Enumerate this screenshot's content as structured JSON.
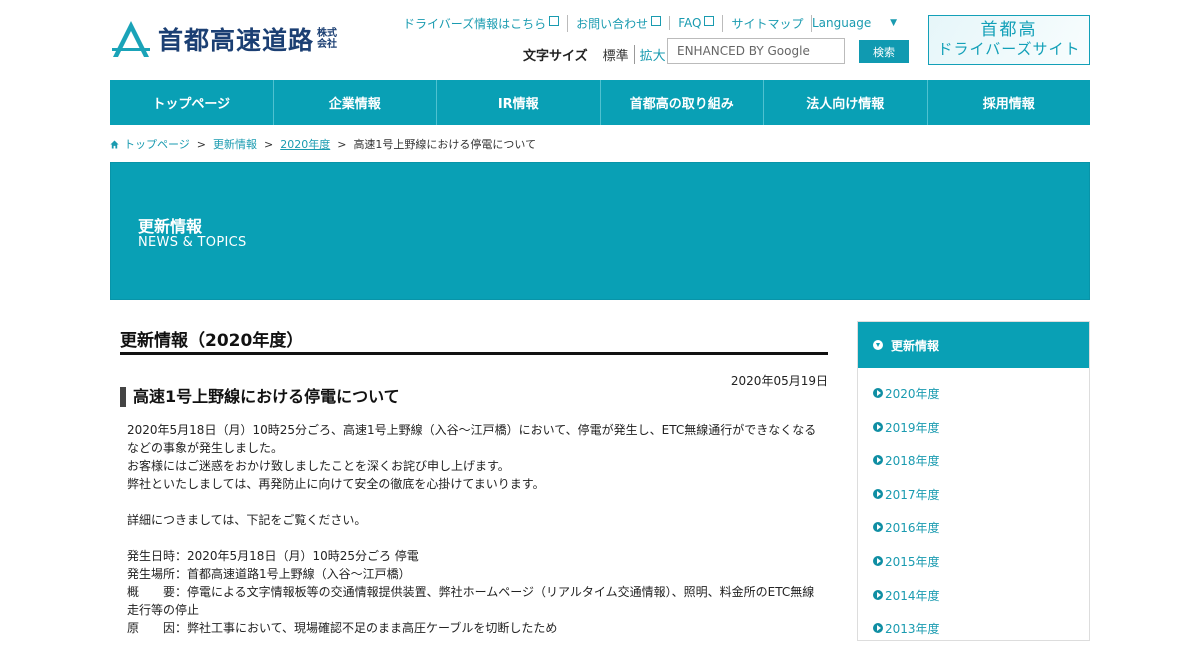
{
  "header": {
    "logo_text": "首都高速道路",
    "logo_suffix": "株式会社",
    "top_links": [
      {
        "label": "ドライバーズ情報はこちら",
        "external": true
      },
      {
        "label": "お問い合わせ",
        "external": true
      },
      {
        "label": "FAQ",
        "external": true
      },
      {
        "label": "サイトマップ",
        "external": false
      }
    ],
    "language_label": "Language",
    "font_size_label": "文字サイズ",
    "font_size_standard": "標準",
    "font_size_large": "拡大",
    "search_placeholder": "ENHANCED BY Google",
    "search_button": "検索",
    "driver_site_line1": "首都高",
    "driver_site_line2": "ドライバーズサイト"
  },
  "nav": [
    "トップページ",
    "企業情報",
    "IR情報",
    "首都高の取り組み",
    "法人向け情報",
    "採用情報"
  ],
  "breadcrumb": [
    "トップページ",
    "更新情報",
    "2020年度",
    "高速1号上野線における停電について"
  ],
  "banner": {
    "title": "更新情報",
    "subtitle": "NEWS & TOPICS"
  },
  "main": {
    "page_title": "更新情報（2020年度）",
    "date": "2020年05月19日",
    "article_title": "高速1号上野線における停電について",
    "paragraphs": [
      "2020年5月18日（月）10時25分ごろ、高速1号上野線（入谷～江戸橋）において、停電が発生し、ETC無線通行ができなくなるなどの事象が発生しました。",
      "お客様にはご迷惑をおかけ致しましたことを深くお詫び申し上げます。",
      "弊社といたしましては、再発防止に向けて安全の徹底を心掛けてまいります。",
      "",
      "詳細につきましては、下記をご覧ください。",
      "",
      "発生日時：2020年5月18日（月）10時25分ごろ 停電",
      "発生場所：首都高速道路1号上野線（入谷～江戸橋）",
      "概　　要：停電による文字情報板等の交通情報提供装置、弊社ホームページ（リアルタイム交通情報）、照明、料金所のETC無線走行等の停止",
      "原　　因：弊社工事において、現場確認不足のまま高圧ケーブルを切断したため"
    ]
  },
  "sidebar": {
    "title": "更新情報",
    "items": [
      "2020年度",
      "2019年度",
      "2018年度",
      "2017年度",
      "2016年度",
      "2015年度",
      "2014年度",
      "2013年度"
    ]
  }
}
